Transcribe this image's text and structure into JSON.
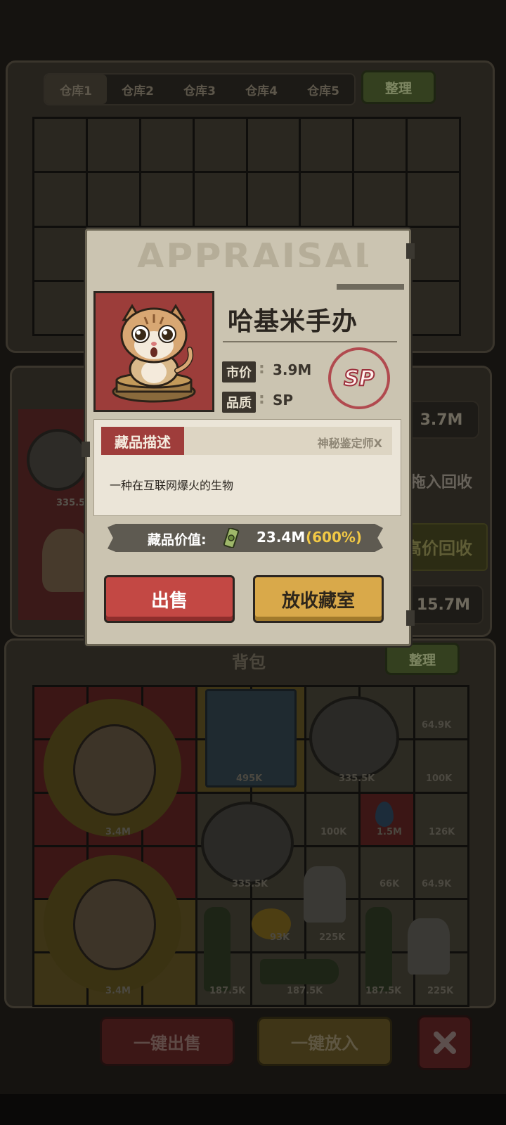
{
  "warehouse": {
    "tabs": [
      "仓库1",
      "仓库2",
      "仓库3",
      "仓库4",
      "仓库5"
    ],
    "sort_label": "整理"
  },
  "side_panel": {
    "value_top": "3.7M",
    "drag_hint": "品拖入回收",
    "high_recycle": "高价回收",
    "value_bottom": "15.7M",
    "item_price": "335.5"
  },
  "backpack": {
    "title": "背包",
    "sort_label": "整理",
    "prices": [
      "3.4M",
      "495K",
      "335.5K",
      "64.9K",
      "100K",
      "100K",
      "1.5M",
      "126K",
      "335.5K",
      "66K",
      "64.9K",
      "3.4M",
      "93K",
      "225K",
      "187.5K",
      "187.5K",
      "187.5K",
      "225K"
    ],
    "sell_all_label": "一键出售",
    "store_all_label": "一键放入"
  },
  "modal": {
    "watermark": "APPRAISAL",
    "item_name": "哈基米手办",
    "market_price_label": "市价",
    "market_price": "3.9M",
    "quality_label": "品质",
    "quality": "SP",
    "stamp_text": "SP",
    "description_tag": "藏品描述",
    "appraiser": "神秘鉴定师X",
    "description": "一种在互联网爆火的生物",
    "value_label": "藏品价值:",
    "value_amount": "23.4M",
    "value_percent": "(600%)",
    "sell_label": "出售",
    "store_label": "放收藏室"
  },
  "colors": {
    "accent_red": "#c34844",
    "accent_gold": "#d9a94a",
    "percent_gold": "#f2c945",
    "stamp_red": "#b14a4f"
  },
  "icons": [
    "cat-figurine-icon",
    "money-icon",
    "close-icon",
    "jet-engine-icon",
    "sun-face-icon",
    "trophy-icon",
    "champagne-bottle-icon"
  ]
}
